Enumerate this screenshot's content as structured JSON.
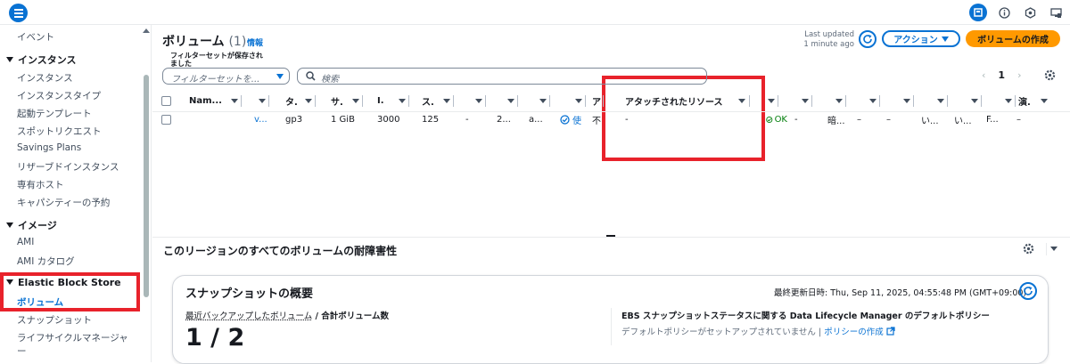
{
  "topbar": {
    "menu_icon": "hamburger-menu-icon",
    "icons": [
      "panel-icon",
      "info-icon",
      "cloudshell-icon",
      "feedback-icon"
    ]
  },
  "sidebar": {
    "item_events": "イベント",
    "section_instances": "インスタンス",
    "instances_items": [
      "インスタンス",
      "インスタンスタイプ",
      "起動テンプレート",
      "スポットリクエスト",
      "Savings Plans",
      "リザーブドインスタンス",
      "専有ホスト",
      "キャパシティーの予約"
    ],
    "section_images": "イメージ",
    "images_items": [
      "AMI",
      "AMI カタログ"
    ],
    "section_ebs": "Elastic Block Store",
    "ebs_items": [
      "ボリューム",
      "スナップショット",
      "ライフサイクルマネージャ",
      "ー"
    ]
  },
  "header": {
    "title": "ボリューム",
    "count": "(1)",
    "info": "情報",
    "last_updated_line1": "Last updated",
    "last_updated_line2": "1 minute ago",
    "actions_label": "アクション",
    "create_label": "ボリュームの作成"
  },
  "filter": {
    "label": "フィルターセットが保存されました",
    "select_placeholder": "フィルターセットを...",
    "search_placeholder": "検索"
  },
  "pagination": {
    "prev": "‹",
    "page": "1",
    "next": "›"
  },
  "table": {
    "headers": [
      "Nam...",
      "",
      "タ.",
      "サ.",
      "I.",
      "ス.",
      "",
      "",
      "",
      "ア",
      "アタッチされたリソース",
      "",
      "",
      "",
      "",
      "",
      "",
      "",
      "演."
    ],
    "row": [
      "",
      "v...",
      "gp3",
      "1 GiB",
      "3000",
      "125",
      "-",
      "2...",
      "a...",
      "使",
      "不",
      "-",
      "OK",
      "-",
      "暗...",
      "–",
      "–",
      "い...",
      "い...",
      "F...",
      "–"
    ]
  },
  "health": {
    "title": "このリージョンのすべてのボリュームの耐障害性"
  },
  "snapshot_card": {
    "title": "スナップショットの概要",
    "last_updated": "最終更新日時: Thu, Sep 11, 2025, 04:55:48 PM (GMT+09:00)",
    "sub_label_link": "最近バックアップしたボリューム",
    "sub_label_rest": " / 合計ボリューム数",
    "value": "1 / 2",
    "ebs_title": "EBS スナップショットステータスに関する Data Lifecycle Manager のデフォルトポリシー",
    "ebs_desc": "デフォルトポリシーがセットアップされていません |",
    "ebs_link": "ポリシーの作成"
  },
  "colors": {
    "accent": "#0972d3",
    "primary_button": "#ff9900",
    "highlight_box": "#e8222b",
    "ok": "#037f0c"
  }
}
